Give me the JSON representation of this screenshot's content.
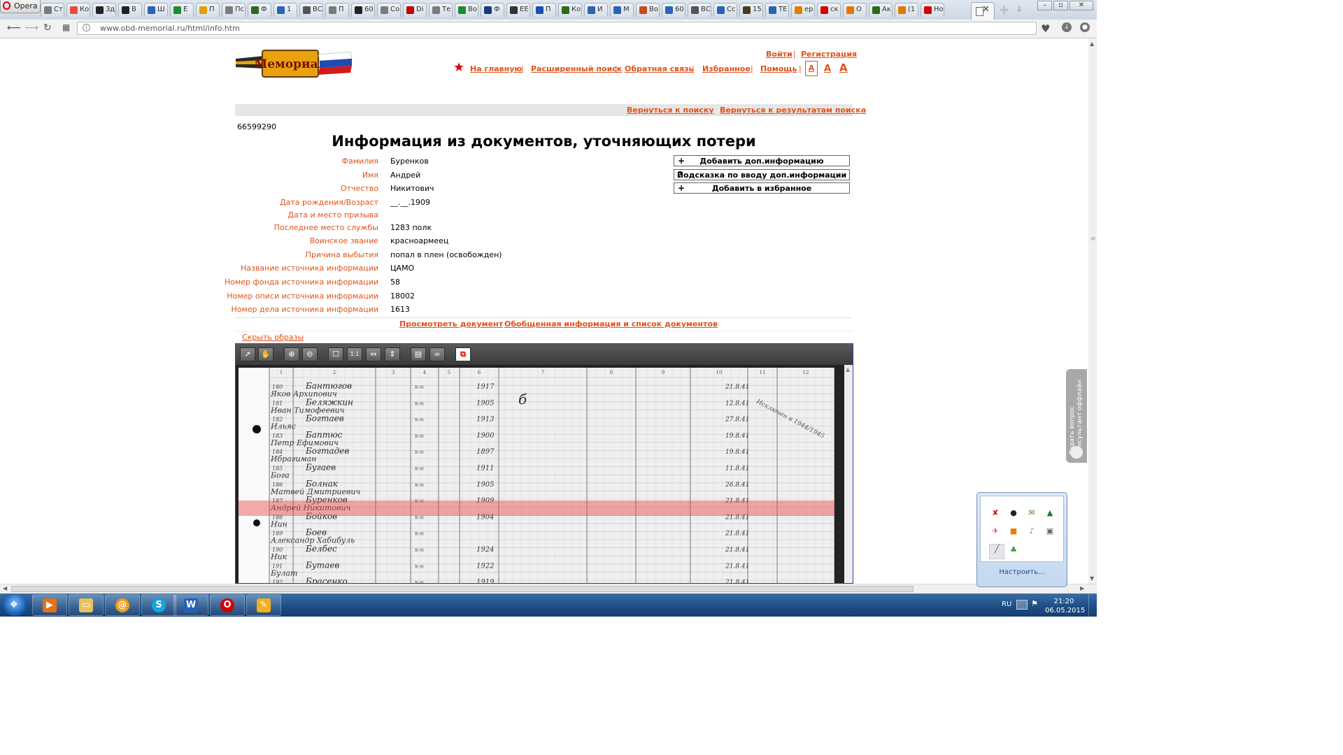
{
  "browser": {
    "menu_label": "Opera",
    "tabs": [
      {
        "label": "Ст",
        "color": "#7b7b7b"
      },
      {
        "label": "Ко",
        "color": "#e84b3a"
      },
      {
        "label": "Зд",
        "color": "#222222"
      },
      {
        "label": "В",
        "color": "#222222"
      },
      {
        "label": "Ш",
        "color": "#2b63b5"
      },
      {
        "label": "Е",
        "color": "#1e8a2e"
      },
      {
        "label": "П",
        "color": "#e0a000"
      },
      {
        "label": "Пс",
        "color": "#7b7b7b"
      },
      {
        "label": "Ф",
        "color": "#2d6a1a"
      },
      {
        "label": "1",
        "color": "#2b63b5"
      },
      {
        "label": "ВС",
        "color": "#555555"
      },
      {
        "label": "П",
        "color": "#7b7b7b"
      },
      {
        "label": "60",
        "color": "#222222"
      },
      {
        "label": "Со",
        "color": "#7b7b7b"
      },
      {
        "label": "Di",
        "color": "#c00000"
      },
      {
        "label": "Те",
        "color": "#7b7b7b"
      },
      {
        "label": "Во",
        "color": "#1e8a2e"
      },
      {
        "label": "Ф",
        "color": "#1a3a7a"
      },
      {
        "label": "ЕЕ",
        "color": "#333333"
      },
      {
        "label": "П",
        "color": "#1b4fb0"
      },
      {
        "label": "Ко",
        "color": "#2d6a1a"
      },
      {
        "label": "И",
        "color": "#2b63b5"
      },
      {
        "label": "М",
        "color": "#2b63b5"
      },
      {
        "label": "Во",
        "color": "#c44b1f"
      },
      {
        "label": "60",
        "color": "#2b63b5"
      },
      {
        "label": "ВС",
        "color": "#555555"
      },
      {
        "label": "Сс",
        "color": "#2b63b5"
      },
      {
        "label": "15",
        "color": "#4a3a20"
      },
      {
        "label": "ТЕ",
        "color": "#2b63b5"
      },
      {
        "label": "ер",
        "color": "#e08000"
      },
      {
        "label": "ск",
        "color": "#d40000"
      },
      {
        "label": "О",
        "color": "#e07800"
      },
      {
        "label": "Ак",
        "color": "#2d6a1a"
      },
      {
        "label": "(1",
        "color": "#e07800"
      },
      {
        "label": "Но",
        "color": "#d40000"
      }
    ],
    "url": "www.obd-memorial.ru/html/info.htm"
  },
  "site": {
    "logo_text": "Мемориал",
    "login": "Войти",
    "register": "Регистрация",
    "nav": [
      "На главную",
      "Расширенный поиск",
      "Обратная связь",
      "Избранное",
      "Помощь"
    ],
    "font_sizes": [
      "А",
      "А",
      "А"
    ],
    "back_to_search": "Вернуться к поиску",
    "back_to_results": "Вернуться к результатам поиска",
    "accent_color": "#e0531b"
  },
  "record": {
    "id": "66599290",
    "title": "Информация из документов, уточняющих потери",
    "fields": [
      {
        "label": "Фамилия",
        "value": "Буренков"
      },
      {
        "label": "Имя",
        "value": "Андрей"
      },
      {
        "label": "Отчество",
        "value": "Никитович"
      },
      {
        "label": "Дата рождения/Возраст",
        "value": "__.__.1909"
      },
      {
        "label": "Дата и место призыва",
        "value": ""
      },
      {
        "label": "Последнее место службы",
        "value": "1283 полк"
      },
      {
        "label": "Воинское звание",
        "value": "красноармеец"
      },
      {
        "label": "Причина выбытия",
        "value": "попал в плен (освобожден)"
      },
      {
        "label": "Название источника информации",
        "value": "ЦАМО"
      },
      {
        "label": "Номер фонда источника информации",
        "value": "58"
      },
      {
        "label": "Номер описи источника информации",
        "value": "18002"
      },
      {
        "label": "Номер дела источника информации",
        "value": "1613"
      }
    ],
    "actions": [
      {
        "symbol": "+",
        "label": "Добавить доп.информацию"
      },
      {
        "symbol": "?",
        "label": "Подсказка по вводу доп.информации"
      },
      {
        "symbol": "+",
        "label": "Добавить в избранное"
      }
    ],
    "view_document": "Просмотреть документ",
    "summary_link": "Обобщенная информация и список документов",
    "hide_images": "Скрыть образы"
  },
  "viewer": {
    "tools": [
      "select-icon",
      "hand-icon",
      "zoom-in-icon",
      "zoom-out-icon",
      "fit-page-icon",
      "actual-size-icon",
      "fit-width-icon",
      "fit-height-icon",
      "save-icon",
      "link-icon",
      "pdf-icon"
    ],
    "column_numbers": [
      "1",
      "2",
      "3",
      "4",
      "5",
      "6",
      "7",
      "8",
      "9",
      "10",
      "11",
      "12"
    ],
    "row_numbers": [
      "180",
      "181",
      "182",
      "183",
      "184",
      "185",
      "186",
      "187",
      "188",
      "189",
      "190",
      "191",
      "192"
    ],
    "surnames": [
      "Бантюгов",
      "Беляжкин",
      "Богтаев",
      "Баптюс",
      "Богтадев",
      "Бугаев",
      "Болнак",
      "Буренков",
      "Бойков",
      "Боев",
      "Белбес",
      "Бутаев",
      "Брасенко"
    ],
    "first_names": [
      "Яков Архипович",
      "Иван Тимофеевич",
      "Ильяс",
      "Петр Ефимович",
      "Ибрагиман",
      "Бога",
      "Матвей Дмитриевич",
      "Андрей Никитович",
      "Нин",
      "Александр Хабибуль",
      "Ник",
      "Булат"
    ],
    "years": [
      "1917",
      "1905",
      "1913",
      "1900",
      "1897",
      "1911",
      "1905",
      "1909",
      "1904",
      "",
      "1924",
      "1922",
      "1919"
    ],
    "dates": [
      "21.8.41",
      "12.8.41",
      "27.8.41",
      "19.8.41",
      "19.8.41",
      "11.8.41",
      "26.8.41",
      "21.8.41",
      "21.8.41",
      "21.8.41",
      "21.8.41",
      "21.8.41",
      "21.8.41"
    ],
    "stamp_text": "Исключен в 1944/1945",
    "highlight_color": "#eb4646"
  },
  "consultant": {
    "line1": "Задать вопрос",
    "line2": "консультант оффлайн"
  },
  "tray_popup": {
    "customize": "Настроить..."
  },
  "taskbar": {
    "apps": [
      "media-player-icon",
      "explorer-icon",
      "mail-icon",
      "skype-icon",
      "word-icon",
      "opera-icon",
      "paint-icon"
    ],
    "language": "RU",
    "time": "21:20",
    "date": "06.05.2015"
  }
}
